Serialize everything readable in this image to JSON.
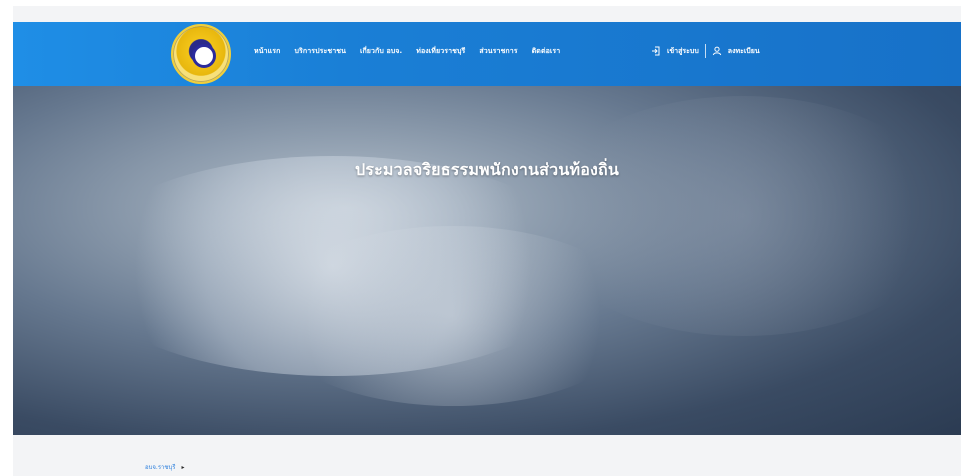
{
  "header": {
    "nav": [
      {
        "label": "หน้าแรก"
      },
      {
        "label": "บริการประชาชน"
      },
      {
        "label": "เกี่ยวกับ อบจ."
      },
      {
        "label": "ท่องเที่ยวราชบุรี"
      },
      {
        "label": "ส่วนราชการ"
      },
      {
        "label": "ติดต่อเรา"
      }
    ],
    "login_label": "เข้าสู่ระบบ",
    "register_label": "ลงทะเบียน"
  },
  "hero": {
    "title": "ประมวลจริยธรรมพนักงานส่วนท้องถิ่น"
  },
  "breadcrumb": {
    "item": "อบจ.ราชบุรี"
  },
  "colors": {
    "nav_blue": "#1a7fd6",
    "breadcrumb_link": "#2d7fdc"
  },
  "icons": {
    "login_icon": "login-icon",
    "user_icon": "user-icon"
  }
}
